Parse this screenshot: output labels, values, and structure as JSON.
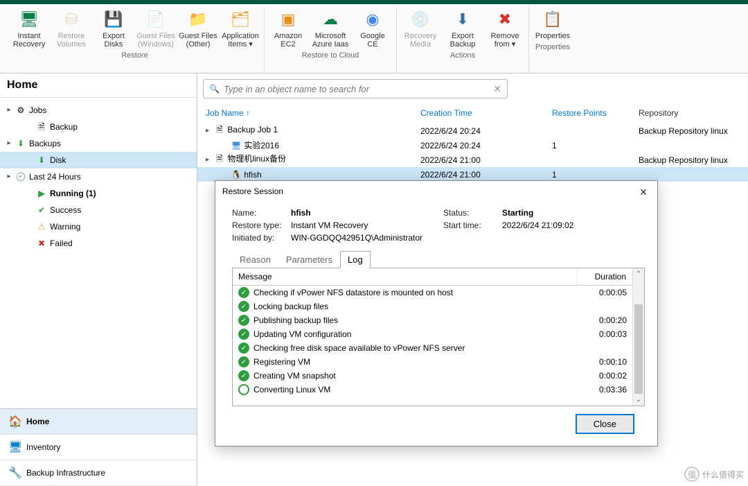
{
  "ribbon": {
    "groups": [
      {
        "label": "Restore",
        "items": [
          {
            "name": "instant-recovery",
            "label": "Instant\nRecovery",
            "icon": "🖥",
            "color": "#0a7e46"
          },
          {
            "name": "restore-volumes",
            "label": "Restore\nVolumes",
            "icon": "⛁",
            "color": "#c7a55a",
            "disabled": true
          },
          {
            "name": "export-disks",
            "label": "Export\nDisks",
            "icon": "💾",
            "color": "#2e9e3f"
          },
          {
            "name": "guest-files-windows",
            "label": "Guest Files\n(Windows)",
            "icon": "📄",
            "color": "#999",
            "disabled": true
          },
          {
            "name": "guest-files-other",
            "label": "Guest Files\n(Other)",
            "icon": "📁",
            "color": "#e8a13a"
          },
          {
            "name": "application-items",
            "label": "Application\nItems ▾",
            "icon": "🗂",
            "color": "#e8a13a"
          }
        ]
      },
      {
        "label": "Restore to Cloud",
        "items": [
          {
            "name": "amazon-ec2",
            "label": "Amazon\nEC2",
            "icon": "▣",
            "color": "#e88c1a"
          },
          {
            "name": "microsoft-azure",
            "label": "Microsoft\nAzure Iaas",
            "icon": "☁",
            "color": "#0a7e46"
          },
          {
            "name": "google-ce",
            "label": "Google\nCE",
            "icon": "◉",
            "color": "#4285f4"
          }
        ]
      },
      {
        "label": "Actions",
        "items": [
          {
            "name": "recovery-media",
            "label": "Recovery\nMedia",
            "icon": "💿",
            "color": "#999",
            "disabled": true
          },
          {
            "name": "export-backup",
            "label": "Export\nBackup",
            "icon": "⬇",
            "color": "#2f6fa8"
          },
          {
            "name": "remove-from",
            "label": "Remove\nfrom ▾",
            "icon": "✖",
            "color": "#d9312a"
          }
        ]
      },
      {
        "label": "Properties",
        "items": [
          {
            "name": "properties",
            "label": "Properties",
            "icon": "📋",
            "color": "#e8a13a"
          }
        ]
      }
    ]
  },
  "sidebar": {
    "header": "Home",
    "tree": [
      {
        "name": "jobs",
        "expand": "▸",
        "icon": "⚙",
        "label": "Jobs",
        "indent": 0
      },
      {
        "name": "jobs-backup",
        "icon": "🗎",
        "label": "Backup",
        "indent": 1
      },
      {
        "name": "backups",
        "expand": "▸",
        "icon": "⬇",
        "color": "#2e9e3f",
        "label": "Backups",
        "indent": 0
      },
      {
        "name": "backups-disk",
        "icon": "⬇",
        "color": "#2e9e3f",
        "label": "Disk",
        "indent": 1,
        "selected": true
      },
      {
        "name": "last24",
        "expand": "▸",
        "icon": "🕘",
        "label": "Last 24 Hours",
        "indent": 0
      },
      {
        "name": "running",
        "icon": "▶",
        "color": "#2e9e3f",
        "label": "Running (1)",
        "indent": 1,
        "bold": true
      },
      {
        "name": "success",
        "icon": "✔",
        "color": "#2e9e3f",
        "label": "Success",
        "indent": 1
      },
      {
        "name": "warning",
        "icon": "⚠",
        "color": "#e8a13a",
        "label": "Warning",
        "indent": 1
      },
      {
        "name": "failed",
        "icon": "✖",
        "color": "#d9312a",
        "label": "Failed",
        "indent": 1
      }
    ],
    "nav": [
      {
        "name": "home",
        "icon": "🏠",
        "color": "#0a7ec2",
        "label": "Home",
        "active": true
      },
      {
        "name": "inventory",
        "icon": "🖥",
        "color": "#0a7ec2",
        "label": "Inventory"
      },
      {
        "name": "backup-infra",
        "icon": "🔧",
        "color": "#0a7ec2",
        "label": "Backup Infrastructure"
      }
    ]
  },
  "search": {
    "placeholder": "Type in an object name to search for"
  },
  "grid": {
    "cols": {
      "name": "Job Name",
      "ct": "Creation Time",
      "rp": "Restore Points",
      "repo": "Repository"
    },
    "rows": [
      {
        "expand": "▸",
        "icon": "🗎",
        "name": "Backup Job 1",
        "ct": "2022/6/24 20:24",
        "rp": "",
        "repo": "Backup Repository linux",
        "indent": 0
      },
      {
        "icon": "🖥",
        "iconColor": "#3a8fd6",
        "name": "实验2016",
        "ct": "2022/6/24 20:24",
        "rp": "1",
        "repo": "",
        "indent": 1
      },
      {
        "expand": "▸",
        "icon": "🗎",
        "name": "物理机linux备份",
        "ct": "2022/6/24 21:00",
        "rp": "",
        "repo": "Backup Repository linux",
        "indent": 0
      },
      {
        "icon": "🐧",
        "name": "hfish",
        "ct": "2022/6/24 21:00",
        "rp": "1",
        "repo": "",
        "indent": 1,
        "selected": true
      }
    ]
  },
  "dialog": {
    "title": "Restore Session",
    "info": {
      "name_k": "Name:",
      "name_v": "hfish",
      "status_k": "Status:",
      "status_v": "Starting",
      "type_k": "Restore type:",
      "type_v": "Instant VM Recovery",
      "start_k": "Start time:",
      "start_v": "2022/6/24 21:09:02",
      "init_k": "Initiated by:",
      "init_v": "WIN-GGDQQ42951Q\\Administrator"
    },
    "tabs": [
      "Reason",
      "Parameters",
      "Log"
    ],
    "activeTab": 2,
    "log": {
      "cols": {
        "msg": "Message",
        "dur": "Duration"
      },
      "rows": [
        {
          "status": "ok",
          "msg": "Checking if vPower NFS datastore is mounted on host",
          "dur": "0:00:05"
        },
        {
          "status": "ok",
          "msg": "Locking backup files",
          "dur": ""
        },
        {
          "status": "ok",
          "msg": "Publishing backup files",
          "dur": "0:00:20"
        },
        {
          "status": "ok",
          "msg": "Updating VM configuration",
          "dur": "0:00:03"
        },
        {
          "status": "ok",
          "msg": "Checking free disk space available to vPower NFS server",
          "dur": ""
        },
        {
          "status": "ok",
          "msg": "Registering VM",
          "dur": "0:00:10"
        },
        {
          "status": "ok",
          "msg": "Creating VM snapshot",
          "dur": "0:00:02"
        },
        {
          "status": "run",
          "msg": "Converting Linux VM",
          "dur": "0:03:36"
        }
      ]
    },
    "close": "Close"
  },
  "watermark": "什么值得买"
}
